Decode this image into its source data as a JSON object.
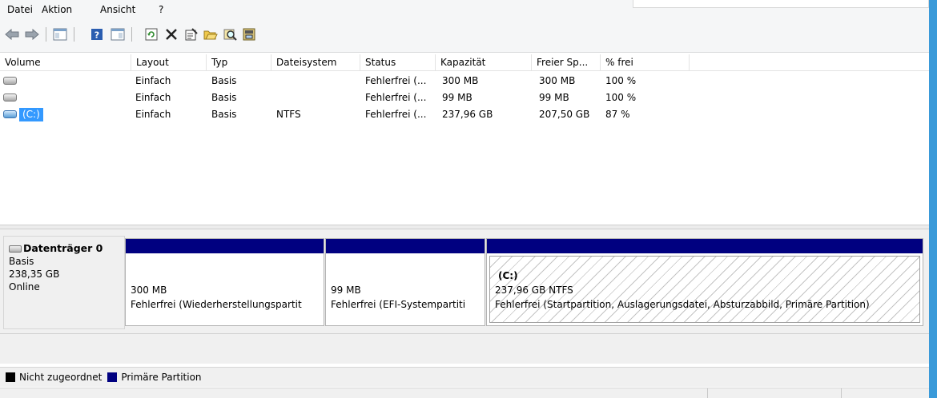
{
  "menu": {
    "items": [
      "Datei",
      "Aktion",
      "Ansicht",
      "?"
    ]
  },
  "toolbar": {
    "icons": [
      "back-arrow-icon",
      "forward-arrow-icon",
      "console-tree-icon",
      "help-icon",
      "properties-pane-icon",
      "refresh-icon",
      "delete-icon",
      "properties-icon",
      "open-icon",
      "explore-icon",
      "disk-settings-icon"
    ]
  },
  "volume_table": {
    "columns": [
      "Volume",
      "Layout",
      "Typ",
      "Dateisystem",
      "Status",
      "Kapazität",
      "Freier Sp...",
      "% frei"
    ],
    "rows": [
      {
        "volume": "",
        "layout": "Einfach",
        "typ": "Basis",
        "dateisystem": "",
        "status": "Fehlerfrei (...",
        "kapazitaet": "300 MB",
        "frei": "300 MB",
        "prozent": "100 %"
      },
      {
        "volume": "",
        "layout": "Einfach",
        "typ": "Basis",
        "dateisystem": "",
        "status": "Fehlerfrei (...",
        "kapazitaet": "99 MB",
        "frei": "99 MB",
        "prozent": "100 %"
      },
      {
        "volume": "(C:)",
        "layout": "Einfach",
        "typ": "Basis",
        "dateisystem": "NTFS",
        "status": "Fehlerfrei (...",
        "kapazitaet": "237,96 GB",
        "frei": "207,50 GB",
        "prozent": "87 %"
      }
    ]
  },
  "disk": {
    "title": "Datenträger 0",
    "type": "Basis",
    "size": "238,35 GB",
    "state": "Online",
    "partitions": [
      {
        "name": "",
        "size": "300 MB",
        "status": "Fehlerfrei (Wiederherstellungspartit"
      },
      {
        "name": "",
        "size": "99 MB",
        "status": "Fehlerfrei (EFI-Systempartiti"
      },
      {
        "name": "(C:)",
        "size": "237,96 GB NTFS",
        "status": "Fehlerfrei (Startpartition, Auslagerungsdatei, Absturzabbild, Primäre Partition)"
      }
    ]
  },
  "legend": {
    "unallocated": "Nicht zugeordnet",
    "primary": "Primäre Partition",
    "unallocated_color": "#000000",
    "primary_color": "#000080"
  },
  "colors": {
    "accent": "#3a9ad9",
    "selection": "#3399ff",
    "partition_bar": "#000080"
  }
}
